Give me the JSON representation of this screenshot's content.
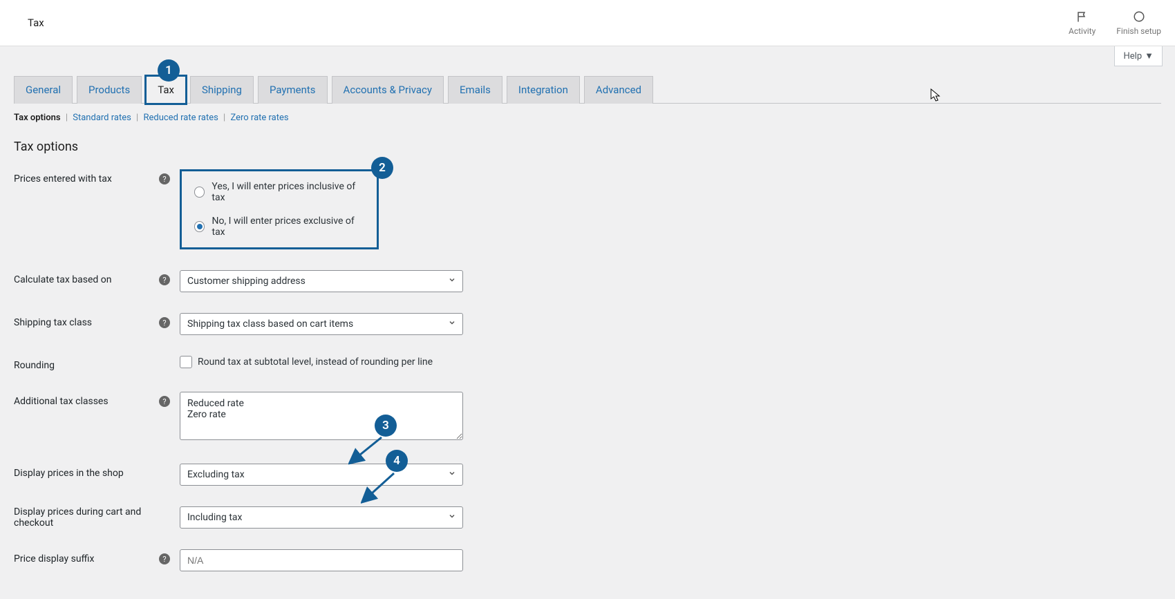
{
  "header": {
    "title": "Tax",
    "activity_label": "Activity",
    "finish_label": "Finish setup",
    "help_label": "Help"
  },
  "tabs": {
    "general": "General",
    "products": "Products",
    "tax": "Tax",
    "shipping": "Shipping",
    "payments": "Payments",
    "accounts": "Accounts & Privacy",
    "emails": "Emails",
    "integration": "Integration",
    "advanced": "Advanced"
  },
  "subtabs": {
    "tax_options": "Tax options",
    "standard": "Standard rates",
    "reduced": "Reduced rate rates",
    "zero": "Zero rate rates"
  },
  "section_title": "Tax options",
  "fields": {
    "prices_entered": {
      "label": "Prices entered with tax",
      "opt_yes": "Yes, I will enter prices inclusive of tax",
      "opt_no": "No, I will enter prices exclusive of tax"
    },
    "calc_tax": {
      "label": "Calculate tax based on",
      "value": "Customer shipping address"
    },
    "shipping_class": {
      "label": "Shipping tax class",
      "value": "Shipping tax class based on cart items"
    },
    "rounding": {
      "label": "Rounding",
      "checkbox_label": "Round tax at subtotal level, instead of rounding per line"
    },
    "additional_classes": {
      "label": "Additional tax classes",
      "value": "Reduced rate\nZero rate"
    },
    "display_shop": {
      "label": "Display prices in the shop",
      "value": "Excluding tax"
    },
    "display_cart": {
      "label": "Display prices during cart and checkout",
      "value": "Including tax"
    },
    "price_suffix": {
      "label": "Price display suffix",
      "placeholder": "N/A"
    }
  },
  "annotations": {
    "b1": "1",
    "b2": "2",
    "b3": "3",
    "b4": "4"
  }
}
